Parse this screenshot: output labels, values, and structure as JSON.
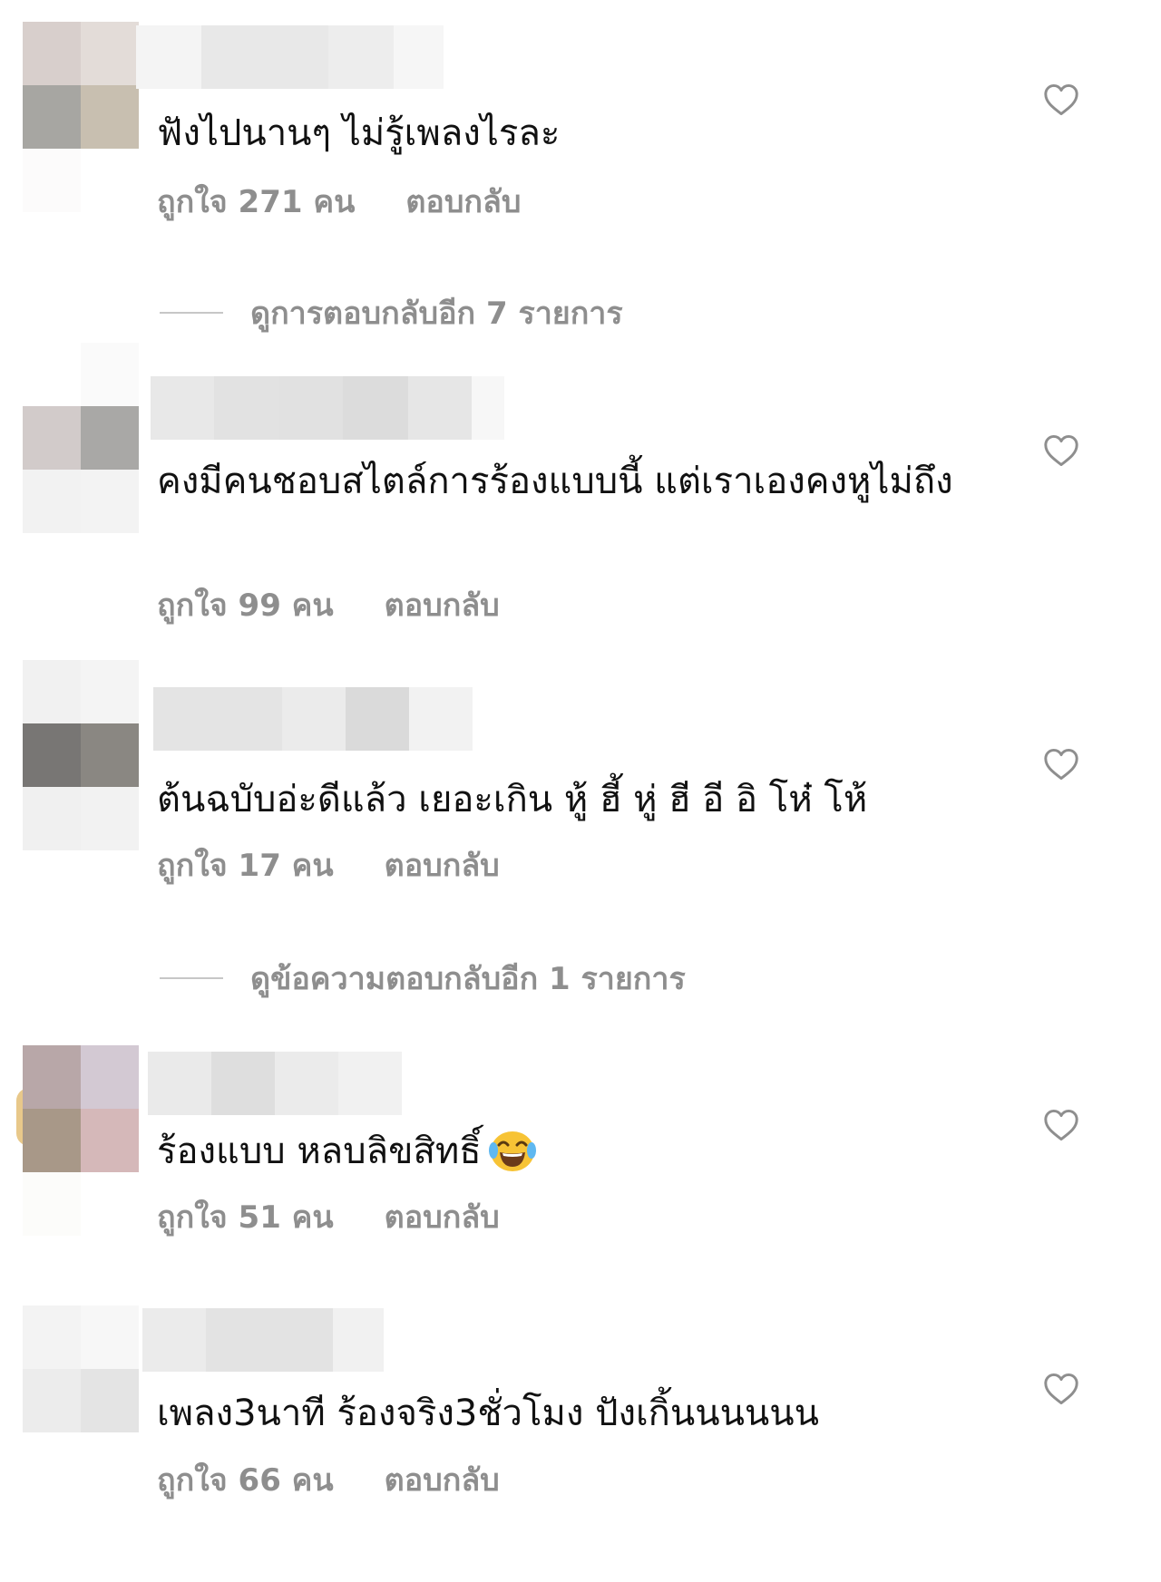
{
  "comments": [
    {
      "text": "ฟังไปนานๆ ไม่รู้เพลงไรละ",
      "likes": "ถูกใจ 271 คน",
      "reply": "ตอบกลับ",
      "like_icon": "heart-outline-icon",
      "view_replies": "ดูการตอบกลับอีก 7 รายการ"
    },
    {
      "text": "คงมีคนชอบสไตล์การร้องแบบนี้ แต่เราเองคงหูไม่ถึง",
      "likes": "ถูกใจ 99 คน",
      "reply": "ตอบกลับ",
      "like_icon": "heart-outline-icon"
    },
    {
      "text": "ต้นฉบับอ่ะดีแล้ว  เยอะเกิน หู้ ฮี้ หู่ ฮี อี อิ โห๋ โห้",
      "likes": "ถูกใจ 17 คน",
      "reply": "ตอบกลับ",
      "like_icon": "heart-outline-icon",
      "view_replies": "ดูข้อความตอบกลับอีก 1 รายการ"
    },
    {
      "text": "ร้องแบบ หลบลิขสิทธิ์",
      "emoji": "face-with-tears-of-joy-emoji",
      "likes": "ถูกใจ 51 คน",
      "reply": "ตอบกลับ",
      "like_icon": "heart-outline-icon"
    },
    {
      "text": "เพลง3นาที ร้องจริง3ชั่วโมง ปังเกิ้นนนนนน",
      "likes": "ถูกใจ 66 คน",
      "reply": "ตอบกลับ",
      "like_icon": "heart-outline-icon"
    }
  ]
}
